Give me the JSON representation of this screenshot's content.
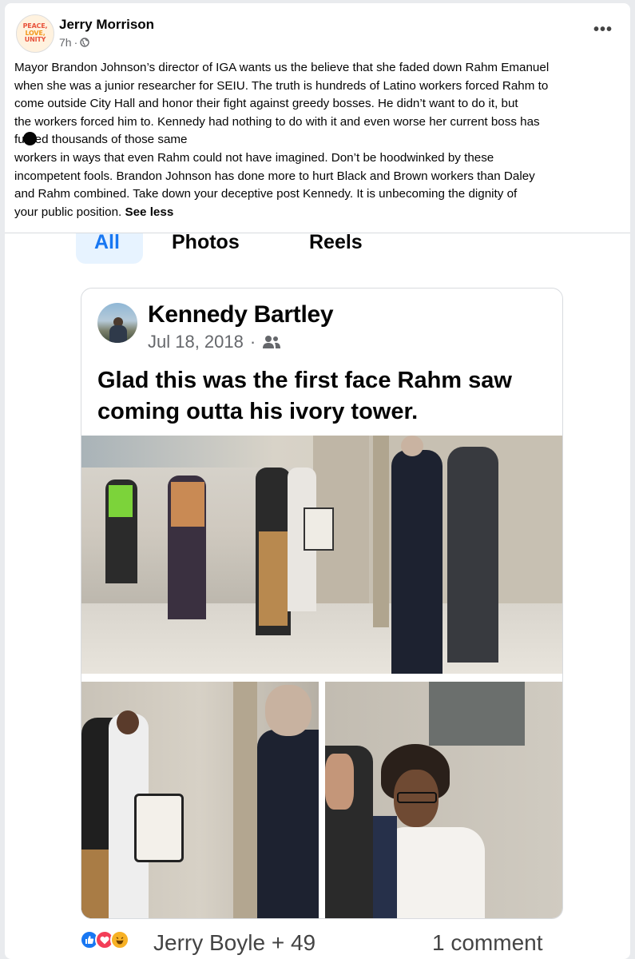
{
  "post": {
    "author": "Jerry Morrison",
    "time": "7h",
    "audience_icon": "globe-icon",
    "avatar_text": [
      "PEACE,",
      "LOVE,",
      "UNITY"
    ],
    "text_lines": [
      "Mayor Brandon Johnson’s director of IGA wants us the believe that she faded down Rahm Emanuel",
      "when she was a junior researcher for SEIU.  The truth is hundreds of Latino workers forced Rahm to",
      "come outside City Hall and honor their fight against greedy bosses.  He didn’t want to do it, but",
      "the workers forced him to.  Kennedy had nothing to do with it and even worse her current boss has"
    ],
    "redacted_line": {
      "prefix": "fu",
      "suffix": "ed thousands of those same"
    },
    "text_lines_after": [
      "workers in ways that even Rahm could not have imagined.  Don’t be hoodwinked by these",
      "incompetent fools.  Brandon Johnson has done more to hurt Black and Brown workers than Daley",
      "and Rahm combined. Take down your deceptive post Kennedy.  It is unbecoming the dignity of"
    ],
    "last_line": "your public position.",
    "see_less": "See less",
    "more_icon": "•••"
  },
  "screenshot": {
    "tabs": [
      "All",
      "Photos",
      "Reels"
    ],
    "shared_post": {
      "author": "Kennedy Bartley",
      "date": "Jul 18, 2018",
      "separator": "·",
      "audience_icon": "friends-icon",
      "caption_lines": [
        "Glad this was the first face Rahm saw",
        "coming outta his ivory tower."
      ]
    },
    "footer": {
      "reaction_icons": [
        "like-icon",
        "love-icon",
        "haha-icon"
      ],
      "reactors": "Jerry Boyle + 49",
      "comments": "1 comment"
    }
  },
  "colors": {
    "accent": "#1877f2",
    "text": "#050505",
    "muted": "#65676b"
  }
}
